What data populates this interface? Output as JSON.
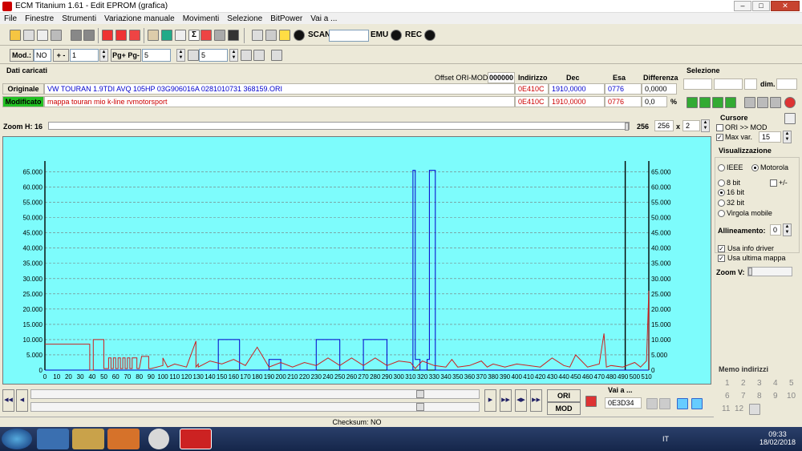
{
  "window": {
    "title": "ECM Titanium 1.61 - Edit EPROM (grafica)"
  },
  "menu": [
    "File",
    "Finestre",
    "Strumenti",
    "Variazione manuale",
    "Movimenti",
    "Selezione",
    "BitPower",
    "Vai a ..."
  ],
  "toolbar": {
    "scan_label": "SCAN",
    "emu_label": "EMU",
    "rec_label": "REC"
  },
  "toolbar2": {
    "mod_label": "Mod.:",
    "mod_value": "NO",
    "plusminus_label": "+ -",
    "step_value": "1",
    "pg_label": "Pg+ Pg-",
    "pg_value": "5",
    "p_value": "5"
  },
  "data_section": {
    "title": "Dati caricati",
    "offset_label": "Offset ORI-MOD",
    "offset_value": "000000",
    "col_indirizzo": "Indirizzo",
    "col_dec": "Dec",
    "col_esa": "Esa",
    "col_diff": "Differenza",
    "originale_label": "Originale",
    "originale_name": "VW TOURAN 1.9TDI AVQ 105HP 03G906016A 0281010731 368159.ORI",
    "originale_addr": "0E410C",
    "originale_dec": "1910,0000",
    "originale_esa": "0776",
    "originale_diff": "0,0000",
    "modificato_label": "Modificato",
    "modificato_name": "mappa touran mio k-line rvmotorsport",
    "modificato_addr": "0E410C",
    "modificato_dec": "1910,0000",
    "modificato_esa": "0776",
    "modificato_diff": "0,0",
    "percent": "%"
  },
  "selezione": {
    "title": "Selezione",
    "dim_label": "dim."
  },
  "zoom": {
    "label": "Zoom H: 16",
    "v1": "256",
    "v2": "256",
    "x": "x",
    "mult": "2"
  },
  "cursore": {
    "title": "Cursore",
    "ori_mod": "ORI >> MOD",
    "maxvar_label": "Max var.",
    "maxvar_value": "15"
  },
  "visualizzazione": {
    "title": "Visualizzazione",
    "ieee": "IEEE",
    "motorola": "Motorola",
    "b8": "8 bit",
    "pm": "+/-",
    "b16": "16 bit",
    "b32": "32 bit",
    "vm": "Virgola mobile",
    "allin_label": "Allineamento:",
    "allin_value": "0",
    "usa_driver": "Usa info driver",
    "usa_mappa": "Usa ultima mappa",
    "zoomv": "Zoom V:"
  },
  "memo": {
    "title": "Memo indirizzi",
    "items": [
      "1",
      "2",
      "3",
      "4",
      "5",
      "6",
      "7",
      "8",
      "9",
      "10",
      "11",
      "12"
    ]
  },
  "bottom": {
    "ori": "ORI",
    "mod": "MOD",
    "vai_label": "Vai a ...",
    "vai_value": "0E3D34"
  },
  "status": {
    "checksum": "Checksum: NO"
  },
  "tray": {
    "lang": "IT",
    "time": "09:33",
    "date": "18/02/2018"
  },
  "chart_data": {
    "type": "line",
    "yticks": [
      "65.000",
      "60.000",
      "55.000",
      "50.000",
      "45.000",
      "40.000",
      "35.000",
      "30.000",
      "25.000",
      "20.000",
      "15.000",
      "10.000",
      "5.000",
      "0"
    ],
    "xticks": [
      "0",
      "10",
      "20",
      "30",
      "40",
      "50",
      "60",
      "70",
      "80",
      "90",
      "100",
      "110",
      "120",
      "130",
      "140",
      "150",
      "160",
      "170",
      "180",
      "190",
      "200",
      "210",
      "220",
      "230",
      "240",
      "250",
      "260",
      "270",
      "280",
      "290",
      "300",
      "310",
      "320",
      "330",
      "340",
      "350",
      "360",
      "370",
      "380",
      "390",
      "400",
      "410",
      "420",
      "430",
      "440",
      "450",
      "460",
      "470",
      "480",
      "490",
      "500",
      "510"
    ],
    "ylim": [
      0,
      67500
    ],
    "xlim": [
      0,
      512
    ],
    "grid": true,
    "colors": {
      "bg": "#7dfcfc",
      "ori": "#0000cc",
      "mod": "#cc2020",
      "grid": "#777777"
    },
    "markers_x": [
      0,
      492,
      512
    ],
    "series": [
      {
        "name": "ORI",
        "x": [
          0,
          30,
          30,
          147,
          147,
          165,
          165,
          165,
          190,
          190,
          200,
          200,
          200,
          230,
          230,
          250,
          250,
          250,
          270,
          270,
          290,
          290,
          290,
          312,
          312,
          314,
          314,
          318,
          318,
          324,
          324,
          326,
          326,
          331,
          331,
          512
        ],
        "values": [
          0,
          0,
          0,
          0,
          10000,
          10000,
          0,
          0,
          0,
          3500,
          3500,
          0,
          0,
          0,
          10000,
          10000,
          0,
          0,
          0,
          10000,
          10000,
          0,
          0,
          0,
          65500,
          65500,
          3500,
          3500,
          0,
          0,
          3500,
          3500,
          65500,
          65500,
          0,
          0
        ]
      },
      {
        "name": "MOD",
        "x": [
          0,
          38,
          38,
          41,
          41,
          50,
          50,
          54,
          54,
          56,
          56,
          58,
          58,
          60,
          60,
          62,
          62,
          64,
          64,
          66,
          66,
          68,
          68,
          70,
          70,
          72,
          72,
          74,
          74,
          78,
          78,
          80,
          82,
          88,
          88,
          90,
          100,
          100,
          104,
          110,
          120,
          128,
          128,
          130,
          130,
          140,
          150,
          160,
          170,
          180,
          190,
          200,
          210,
          220,
          230,
          240,
          250,
          260,
          270,
          280,
          290,
          300,
          310,
          314,
          315,
          320,
          330,
          340,
          345,
          350,
          360,
          370,
          375,
          380,
          390,
          400,
          420,
          430,
          440,
          445,
          450,
          460,
          470,
          474,
          476,
          480,
          490,
          500,
          505,
          510,
          512,
          512
        ],
        "values": [
          8500,
          8500,
          0,
          0,
          10000,
          10000,
          500,
          500,
          4000,
          4000,
          500,
          500,
          4000,
          4000,
          500,
          500,
          4000,
          4000,
          500,
          500,
          4000,
          4000,
          500,
          500,
          4000,
          4000,
          500,
          500,
          4000,
          4000,
          500,
          500,
          4500,
          4500,
          500,
          500,
          1500,
          4000,
          1000,
          2000,
          1000,
          9500,
          1000,
          2000,
          1000,
          3000,
          2000,
          3500,
          1500,
          7500,
          1000,
          2500,
          1000,
          2500,
          1500,
          4000,
          1500,
          4000,
          1500,
          4000,
          1500,
          3000,
          2500,
          500,
          1000,
          3000,
          1500,
          1000,
          3500,
          1000,
          1500,
          3000,
          1000,
          2000,
          1000,
          2000,
          1000,
          4000,
          1500,
          1000,
          5000,
          1000,
          2000,
          12000,
          1000,
          1500,
          1000,
          2500,
          1000,
          3000,
          26000,
          0
        ]
      }
    ]
  }
}
